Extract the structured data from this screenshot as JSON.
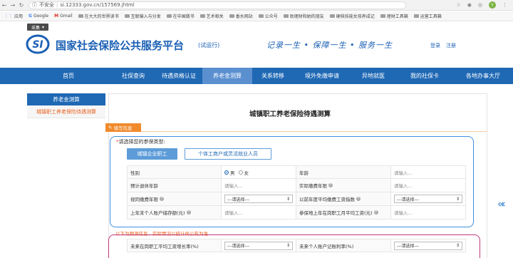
{
  "browser": {
    "security": "不安全",
    "url": "si.12333.gov.cn/157569.jhtml",
    "avatar": "Y"
  },
  "bookmarks": [
    {
      "label": "应用",
      "icon": "apps-icon"
    },
    {
      "label": "Google",
      "icon": "google-icon"
    },
    {
      "label": "Gmail",
      "icon": "gmail-icon"
    },
    {
      "label": "在大大的世界读书",
      "icon": "folder-icon"
    },
    {
      "label": "互联输入与分发",
      "icon": "folder-icon"
    },
    {
      "label": "在中国做书",
      "icon": "folder-icon"
    },
    {
      "label": "艺术相关",
      "icon": "folder-icon"
    },
    {
      "label": "香水网站",
      "icon": "folder-icon"
    },
    {
      "label": "公众号",
      "icon": "folder-icon"
    },
    {
      "label": "助理财和她的朋友",
      "icon": "folder-icon"
    },
    {
      "label": "硬核技能女孩养成记",
      "icon": "folder-icon"
    },
    {
      "label": "理财工具箱",
      "icon": "folder-icon"
    },
    {
      "label": "运营工具箱",
      "icon": "folder-icon"
    }
  ],
  "collect_label": "采集",
  "header": {
    "title": "国家社会保险公共服务平台",
    "subtitle": "(试运行)",
    "slogan": "记录一生 • 保障一生 • 服务一生",
    "login": "登录",
    "register": "注册"
  },
  "nav": [
    {
      "label": "首页"
    },
    {
      "label": "社保查询"
    },
    {
      "label": "待遇资格认证"
    },
    {
      "label": "养老金测算",
      "active": true
    },
    {
      "label": "关系转移"
    },
    {
      "label": "境外免缴申请"
    },
    {
      "label": "异地就医"
    },
    {
      "label": "我的社保卡"
    },
    {
      "label": "各地办事大厅"
    }
  ],
  "sidebar": {
    "header": "养老金测算",
    "item": "城镇职工养老保险待遇测算"
  },
  "main": {
    "title": "城镇职工养老保险待遇测算",
    "tag": "填写信息",
    "ptype_label": "请选择您的参保类型:",
    "ptype_options": [
      "城镇企业职工",
      "个体工商户或灵活就业人员"
    ],
    "rows": [
      {
        "l1": "性别",
        "v1": "radio",
        "l2": "年龄",
        "v2": "请输入..."
      },
      {
        "l1": "预计退休年龄",
        "v1": "请输入...",
        "l2": "实际缴费年限",
        "help2": true,
        "v2": "请输入..."
      },
      {
        "l1": "视同缴费年限",
        "help1": true,
        "v1": "---请选择---",
        "l2": "以前年度平均缴费工资指数",
        "help2": true,
        "v2": "---请选择---"
      },
      {
        "l1": "上年末个人账户储存额(元)",
        "help1": true,
        "v1": "请输入...",
        "l2": "参保地上年在岗职工月平均工资(元)",
        "help2": true,
        "v2": "请输入..."
      }
    ],
    "gender": {
      "male": "男",
      "female": "女"
    },
    "hint": "以下为预测信息，实际情况以统计局公布为准",
    "rows2": [
      {
        "l1": "未来在岗职工平均工资增长率(%)",
        "v1": "---请选择---",
        "l2": "未来个人账户记账利率(%)",
        "v2": "---请选择---"
      }
    ]
  }
}
